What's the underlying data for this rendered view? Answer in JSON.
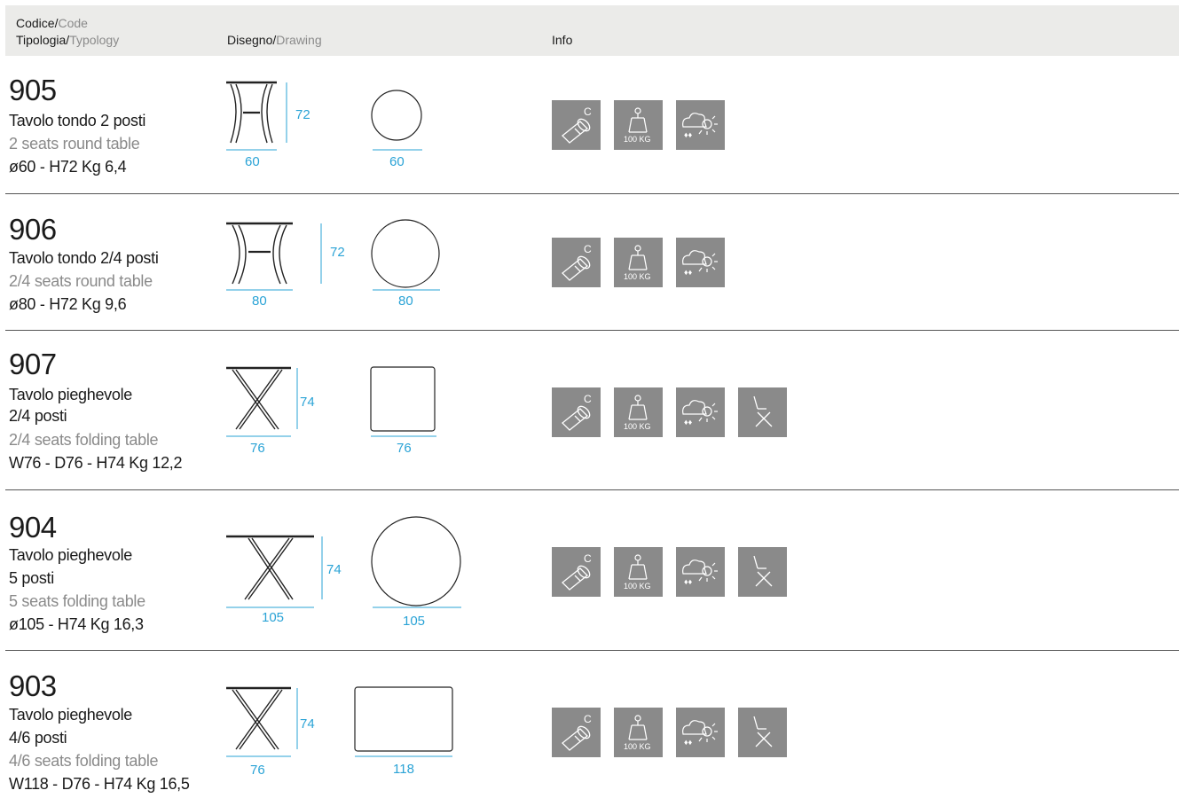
{
  "header": {
    "code_it": "Codice/",
    "code_en": "Code",
    "type_it": "Tipologia/",
    "type_en": "Typology",
    "drawing_it": "Disegno/",
    "drawing_en": "Drawing",
    "info": "Info"
  },
  "products": [
    {
      "code": "905",
      "name_it": [
        "Tavolo tondo 2 posti"
      ],
      "name_en": "2 seats round table",
      "specs": "ø60 - H72  Kg 6,4",
      "dims": {
        "width": "60",
        "height": "72",
        "top": "60"
      },
      "icons": [
        "coating-icon",
        "load-100kg-icon",
        "outdoor-weather-icon"
      ],
      "load_label": "100 KG"
    },
    {
      "code": "906",
      "name_it": [
        "Tavolo tondo 2/4 posti"
      ],
      "name_en": "2/4 seats round table",
      "specs": "ø80 - H72  Kg 9,6",
      "dims": {
        "width": "80",
        "height": "72",
        "top": "80"
      },
      "icons": [
        "coating-icon",
        "load-100kg-icon",
        "outdoor-weather-icon"
      ],
      "load_label": "100 KG"
    },
    {
      "code": "907",
      "name_it": [
        "Tavolo pieghevole",
        "2/4 posti"
      ],
      "name_en": "2/4 seats folding table",
      "specs": "W76 - D76 - H74  Kg 12,2",
      "dims": {
        "width": "76",
        "height": "74",
        "top": "76"
      },
      "icons": [
        "coating-icon",
        "load-100kg-icon",
        "outdoor-weather-icon",
        "folding-icon"
      ],
      "load_label": "100 KG"
    },
    {
      "code": "904",
      "name_it": [
        "Tavolo pieghevole",
        "5 posti"
      ],
      "name_en": "5 seats folding table",
      "specs": "ø105 - H74  Kg 16,3",
      "dims": {
        "width": "105",
        "height": "74",
        "top": "105"
      },
      "icons": [
        "coating-icon",
        "load-100kg-icon",
        "outdoor-weather-icon",
        "folding-icon"
      ],
      "load_label": "100 KG"
    },
    {
      "code": "903",
      "name_it": [
        "Tavolo pieghevole",
        "4/6 posti"
      ],
      "name_en": "4/6 seats folding table",
      "specs": "W118 - D76 - H74  Kg 16,5",
      "dims": {
        "width": "76",
        "height": "74",
        "top": "118"
      },
      "icons": [
        "coating-icon",
        "load-100kg-icon",
        "outdoor-weather-icon",
        "folding-icon"
      ],
      "load_label": "100 KG"
    }
  ],
  "colors": {
    "dimension": "#2aa3d6",
    "icon_bg": "#8a8a8a",
    "header_bg": "#ebebe9"
  }
}
